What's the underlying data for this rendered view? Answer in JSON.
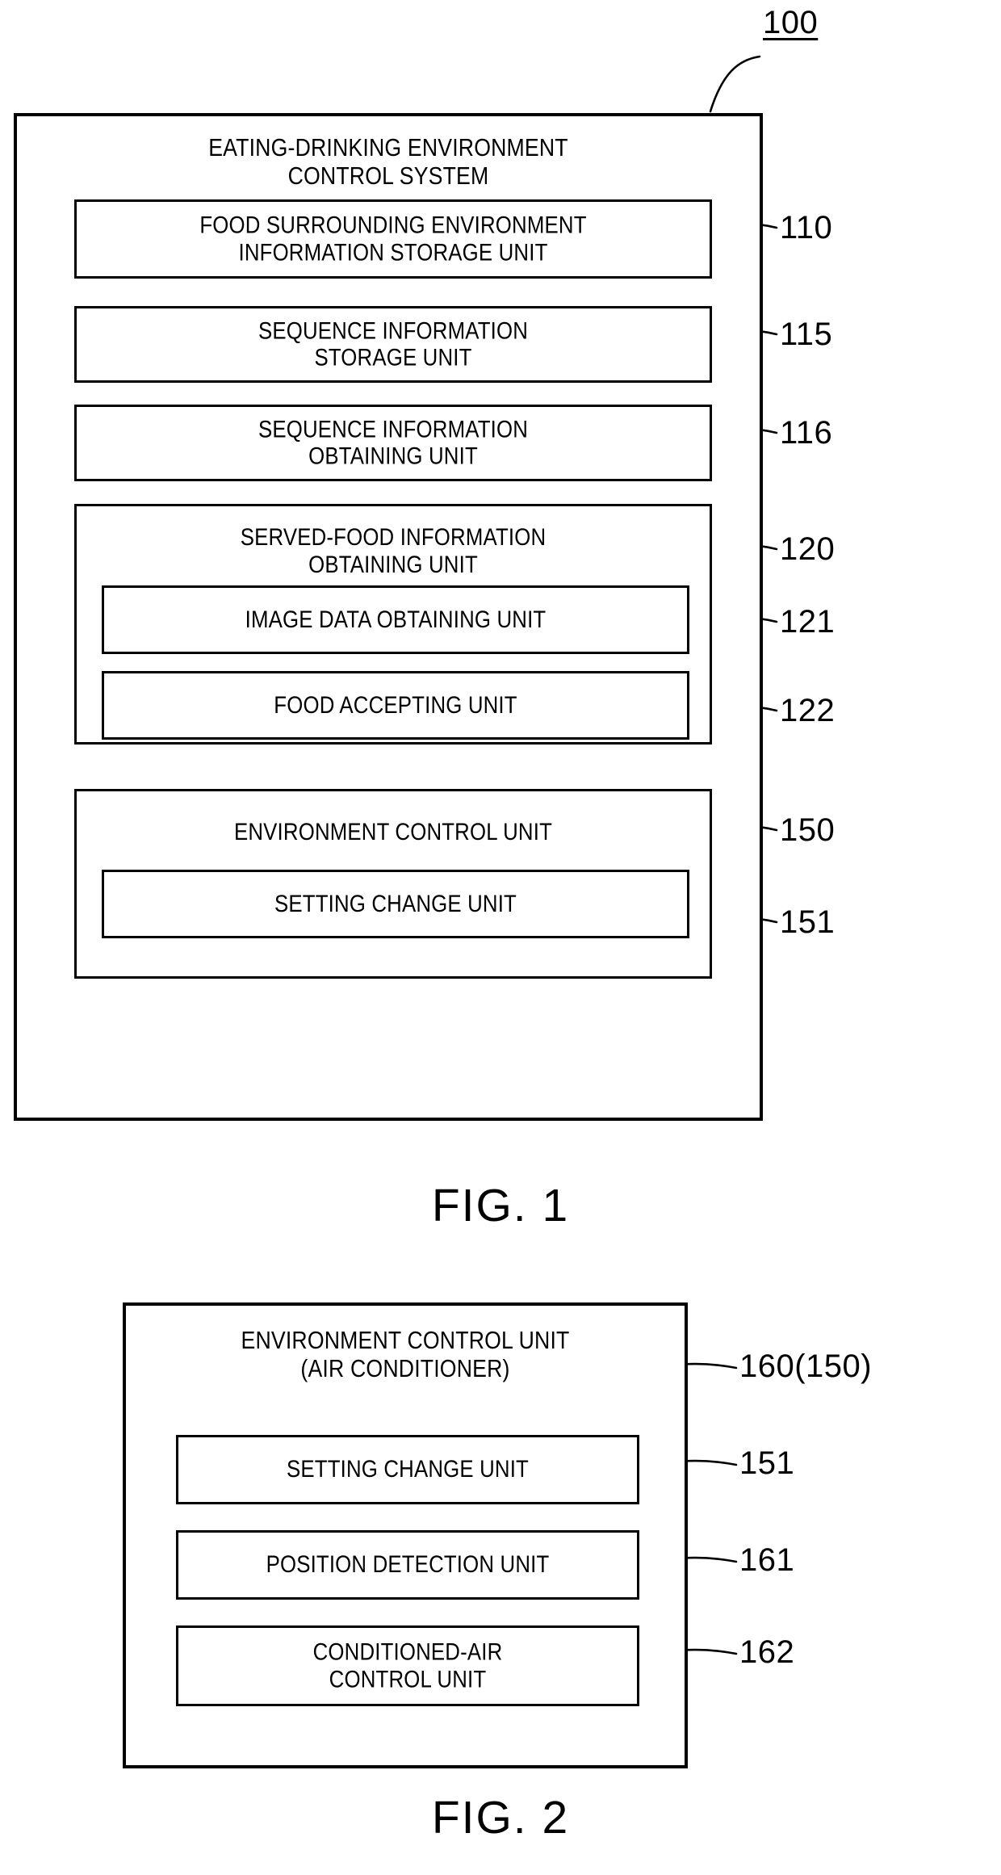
{
  "figures": [
    {
      "caption": "FIG. 1",
      "system_ref": "100",
      "system_title": "EATING-DRINKING ENVIRONMENT\nCONTROL SYSTEM",
      "units": [
        {
          "ref": "110",
          "label": "FOOD SURROUNDING ENVIRONMENT\nINFORMATION STORAGE UNIT"
        },
        {
          "ref": "115",
          "label": "SEQUENCE INFORMATION\nSTORAGE UNIT"
        },
        {
          "ref": "116",
          "label": "SEQUENCE INFORMATION\nOBTAINING UNIT"
        },
        {
          "ref": "120",
          "label": "SERVED-FOOD INFORMATION\nOBTAINING UNIT"
        },
        {
          "ref": "121",
          "label": "IMAGE DATA OBTAINING UNIT"
        },
        {
          "ref": "122",
          "label": "FOOD ACCEPTING UNIT"
        },
        {
          "ref": "150",
          "label": "ENVIRONMENT CONTROL UNIT"
        },
        {
          "ref": "151",
          "label": "SETTING CHANGE UNIT"
        }
      ]
    },
    {
      "caption": "FIG. 2",
      "system_ref": "160(150)",
      "system_title": "ENVIRONMENT CONTROL UNIT\n(AIR CONDITIONER)",
      "units": [
        {
          "ref": "151",
          "label": "SETTING CHANGE UNIT"
        },
        {
          "ref": "161",
          "label": "POSITION DETECTION UNIT"
        },
        {
          "ref": "162",
          "label": "CONDITIONED-AIR\nCONTROL UNIT"
        }
      ]
    }
  ],
  "colors": {
    "ink": "#000000",
    "paper": "#ffffff"
  }
}
